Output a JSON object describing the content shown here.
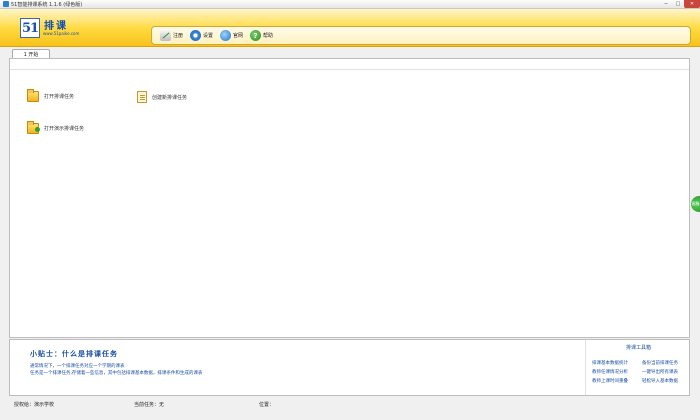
{
  "window": {
    "title": "51智能排课系统 1.1.6 (绿色版)",
    "minimize": "─",
    "maximize": "□",
    "close": "✕"
  },
  "logo": {
    "mark": "51",
    "name": "排课",
    "url": "www.51paike.com"
  },
  "toolbar": {
    "items": [
      {
        "label": "注册",
        "icon": "register-icon"
      },
      {
        "label": "设置",
        "icon": "settings-icon"
      },
      {
        "label": "官网",
        "icon": "website-icon"
      },
      {
        "label": "帮助",
        "icon": "help-icon",
        "glyph": "?"
      }
    ]
  },
  "tabs": [
    {
      "label": "1 开始"
    }
  ],
  "actions": {
    "open_task": "打开排课任务",
    "create_task": "创建新排课任务",
    "open_demo": "打开演示排课任务"
  },
  "side_handle": {
    "label": "客服"
  },
  "tips": {
    "title": "小贴士：什么是排课任务",
    "line1": "通常情况下，一个排课任务对应一个学期的课表",
    "line2": "任务是一个排课任务,存储着一些信息，其中包括排课基本数据，排课条件和生成的课表"
  },
  "tools": {
    "title": "排课工具箱",
    "links": [
      "排课基本数据统计",
      "备份当前排课任务",
      "教师任课情况分析",
      "一键导出所有课表",
      "教师上课时间重叠",
      "轻松导入基本数据"
    ]
  },
  "status": {
    "school": "授权给：演示学校",
    "task": "当前任务：无",
    "location": "位置："
  },
  "colors": {
    "accent": "#1a4fa8",
    "header_yellow": "#ffd93d",
    "close_red": "#c9463d"
  }
}
